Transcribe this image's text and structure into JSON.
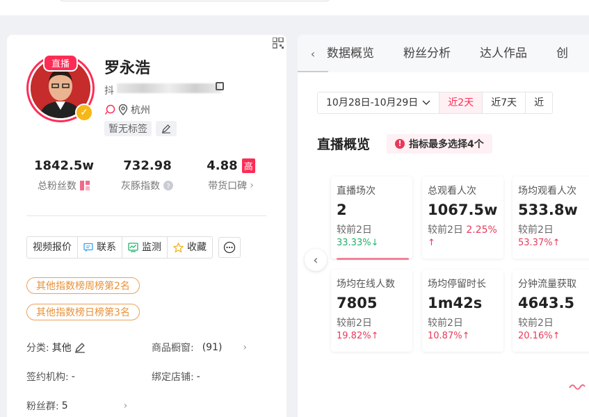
{
  "profile": {
    "live_tag": "直播",
    "name": "罗永浩",
    "account_prefix": "抖",
    "location": "杭州",
    "tag": "暂无标签"
  },
  "stats": [
    {
      "value": "1842.5w",
      "label": "总粉丝数"
    },
    {
      "value": "732.98",
      "label": "灰豚指数"
    },
    {
      "value": "4.88",
      "badge": "高",
      "label": "带货口碑"
    }
  ],
  "actions": {
    "video_quote": "视频报价",
    "contact": "联系",
    "monitor": "监测",
    "favorite": "收藏"
  },
  "ranks": [
    "其他指数榜周榜第2名",
    "其他指数榜日榜第3名"
  ],
  "info": {
    "category_label": "分类:",
    "category_value": "其他",
    "showcase_label": "商品橱窗:",
    "showcase_value": "(91)",
    "agency_label": "签约机构:",
    "agency_value": "-",
    "shop_label": "绑定店铺:",
    "shop_value": "-",
    "fans_group_label": "粉丝群:",
    "fans_group_value": "5"
  },
  "tabs": [
    "数据概览",
    "粉丝分析",
    "达人作品",
    "创"
  ],
  "date": {
    "range": "10月28日-10月29日",
    "options": [
      "近2天",
      "近7天",
      "近"
    ]
  },
  "section": {
    "title": "直播概览",
    "hint": "指标最多选择4个"
  },
  "metrics": [
    {
      "label": "直播场次",
      "value": "2",
      "cmp": "较前2日",
      "change": "33.33%",
      "dir": "down"
    },
    {
      "label": "总观看人次",
      "value": "1067.5w",
      "cmp": "较前2日",
      "change": "2.25%",
      "dir": "up"
    },
    {
      "label": "场均观看人次",
      "value": "533.8w",
      "cmp": "较前2日",
      "change": "53.37%",
      "dir": "up"
    },
    {
      "label": "场均在线人数",
      "value": "7805",
      "cmp": "较前2日",
      "change": "19.82%",
      "dir": "up"
    },
    {
      "label": "场均停留时长",
      "value": "1m42s",
      "cmp": "较前2日",
      "change": "10.87%",
      "dir": "up"
    },
    {
      "label": "分钟流量获取",
      "value": "4643.5",
      "cmp": "较前2日",
      "change": "20.16%",
      "dir": "up"
    }
  ],
  "colors": {
    "accent": "#fe2c55",
    "up": "#e8395a",
    "down": "#20b26b",
    "rank": "#e8913a"
  }
}
